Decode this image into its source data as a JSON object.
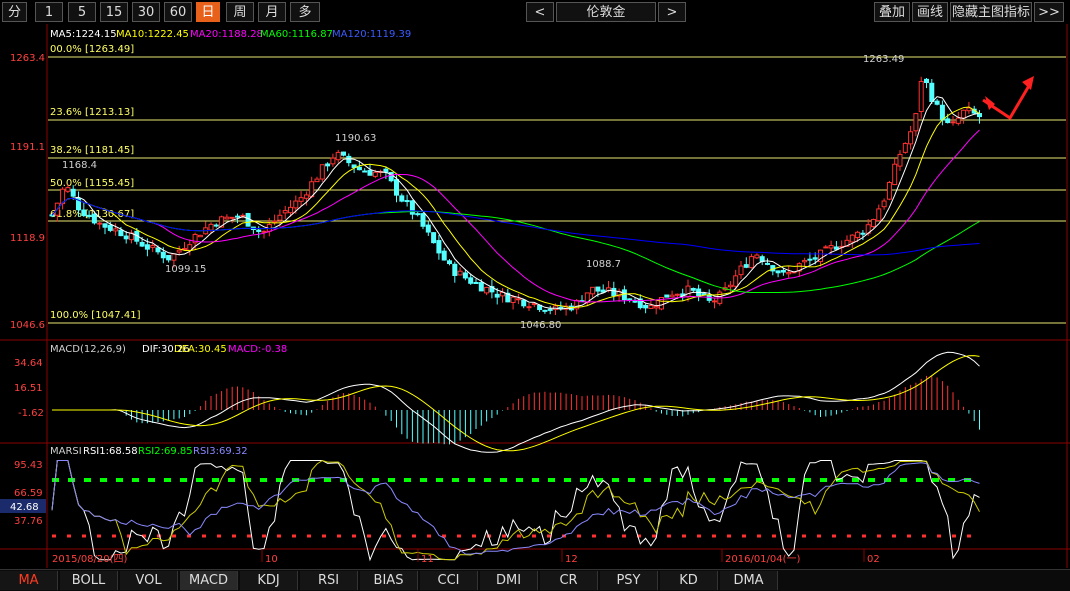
{
  "toolbar": {
    "periods": [
      "分",
      "1",
      "5",
      "15",
      "30",
      "60",
      "日",
      "周",
      "月",
      "多"
    ],
    "active_period": "日",
    "prev": "<",
    "symbol": "伦敦金",
    "next": ">",
    "overlay": "叠加",
    "draw_line": "画线",
    "hide_indicator": "隐藏主图指标",
    "more": ">>"
  },
  "main_chart": {
    "ma_legend": [
      {
        "text": "MA5:1224.15",
        "color": "#ffffff"
      },
      {
        "text": "MA10:1222.45",
        "color": "#ffff00"
      },
      {
        "text": "MA20:1188.28",
        "color": "#ff00ff"
      },
      {
        "text": "MA60:1116.87",
        "color": "#00ff00"
      },
      {
        "text": "MA120:1119.39",
        "color": "#0000ff"
      }
    ],
    "y_ticks": [
      "1263.4",
      "1191.1",
      "1118.9",
      "1046.6"
    ],
    "fib_levels": [
      {
        "label": "00.0% [1263.49]",
        "value": 1263.49
      },
      {
        "label": "23.6% [1213.13]",
        "value": 1213.13
      },
      {
        "label": "38.2% [1181.45]",
        "value": 1181.45
      },
      {
        "label": "50.0% [1155.45]",
        "value": 1155.45
      },
      {
        "label": "61.8% [1130.67]",
        "value": 1130.67
      },
      {
        "label": "100.0% [1047.41]",
        "value": 1047.41
      }
    ],
    "annotations": [
      "1263.49",
      "1190.63",
      "1168.4",
      "1099.15",
      "1088.7",
      "1046.80"
    ]
  },
  "macd": {
    "title": "MACD(12,26,9)",
    "dif": "DIF:30.26",
    "dea": "DEA:30.45",
    "macd": "MACD:-0.38",
    "y_ticks": [
      "34.64",
      "16.51",
      "-1.62"
    ]
  },
  "rsi": {
    "title": "MARSI",
    "rsi1": "RSI1:68.58",
    "rsi2": "RSI2:69.85",
    "rsi3": "RSI3:69.32",
    "y_ticks": [
      "95.43",
      "66.59",
      "37.76"
    ],
    "current": "42.68"
  },
  "x_axis": {
    "labels": [
      "2015/08/20(四)",
      "10",
      "11",
      "12",
      "2016/01/04(一)",
      "02"
    ]
  },
  "bottom_tabs": [
    "MA",
    "BOLL",
    "VOL",
    "MACD",
    "KDJ",
    "RSI",
    "BIAS",
    "CCI",
    "DMI",
    "CR",
    "PSY",
    "KD",
    "DMA"
  ],
  "colors": {
    "up": "#ff3232",
    "down": "#54ffff",
    "fib": "#ffff66",
    "ma5": "#ffffff",
    "ma10": "#ffff00",
    "ma20": "#ff00ff",
    "ma60": "#00ff00",
    "ma120": "#0000ff",
    "active_tab": "#e8611a"
  }
}
